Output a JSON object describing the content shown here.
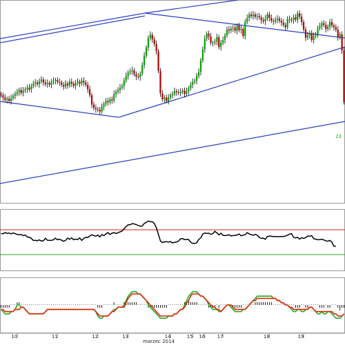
{
  "colors": {
    "background": "#ffffff",
    "bull": "#00a000",
    "bear": "#b00000",
    "wick": "#000000",
    "trendline": "#2a3fbf",
    "osc_line": "#000000",
    "overbought": "#cc2222",
    "oversold": "#22aa22",
    "macd_line": "#22aa22",
    "signal_line": "#dd2200",
    "histogram": "#000000",
    "panel_border": "#999999"
  },
  "chart_data": [
    {
      "type": "candlestick",
      "x": [
        0,
        1,
        2,
        3,
        4,
        5,
        6,
        7,
        8,
        9,
        10,
        11,
        12,
        13,
        14,
        15,
        16,
        17,
        18,
        19,
        20,
        21,
        22,
        23,
        24,
        25,
        26,
        27,
        28,
        29,
        30,
        31,
        32,
        33,
        34,
        35,
        36,
        37,
        38,
        39,
        40,
        41,
        42,
        43,
        44,
        45,
        46,
        47,
        48,
        49,
        50,
        51,
        52,
        53,
        54,
        55,
        56,
        57,
        58,
        59,
        60,
        61,
        62,
        63,
        64,
        65,
        66,
        67,
        68,
        69,
        70,
        71,
        72,
        73,
        74,
        75,
        76,
        77,
        78,
        79,
        80,
        81,
        82,
        83,
        84,
        85,
        86,
        87,
        88,
        89,
        90,
        91,
        92,
        93,
        94,
        95,
        96,
        97,
        98,
        99,
        100,
        101,
        102,
        103,
        104,
        105,
        106,
        107,
        108,
        109,
        110,
        111,
        112,
        113,
        114,
        115,
        116,
        117,
        118,
        119,
        120,
        121,
        122,
        123,
        124,
        125,
        126,
        127,
        128,
        129,
        130,
        131,
        132,
        133,
        134,
        135,
        136,
        137,
        138,
        139,
        140,
        141,
        142,
        143,
        144,
        145,
        146,
        147,
        148,
        149,
        150,
        151,
        152,
        153,
        154,
        155,
        156,
        157,
        158,
        159,
        160,
        161,
        162,
        163,
        164,
        165,
        166,
        167,
        168,
        169,
        170
      ],
      "close": [
        108,
        104,
        100,
        102,
        98,
        103,
        107,
        110,
        113,
        117,
        112,
        116,
        118,
        121,
        118,
        124,
        128,
        130,
        127,
        132,
        135,
        130,
        127,
        129,
        126,
        131,
        133,
        134,
        131,
        130,
        126,
        123,
        128,
        125,
        131,
        128,
        124,
        129,
        131,
        128,
        133,
        130,
        126,
        118,
        108,
        92,
        86,
        84,
        83,
        80,
        88,
        93,
        98,
        96,
        101,
        99,
        110,
        114,
        117,
        121,
        124,
        133,
        141,
        147,
        149,
        151,
        144,
        140,
        139,
        145,
        160,
        176,
        190,
        206,
        212,
        204,
        196,
        184,
        150,
        111,
        101,
        104,
        98,
        104,
        108,
        110,
        115,
        113,
        112,
        114,
        116,
        110,
        115,
        120,
        126,
        131,
        133,
        141,
        148,
        168,
        187,
        205,
        214,
        209,
        198,
        198,
        200,
        208,
        191,
        198,
        203,
        211,
        221,
        219,
        223,
        224,
        219,
        228,
        220,
        222,
        210,
        234,
        241,
        247,
        244,
        247,
        243,
        244,
        242,
        237,
        235,
        240,
        247,
        241,
        236,
        235,
        238,
        240,
        236,
        233,
        229,
        225,
        239,
        238,
        237,
        242,
        238,
        249,
        243,
        234,
        221,
        207,
        211,
        215,
        203,
        210,
        213,
        223,
        227,
        232,
        229,
        222,
        226,
        234,
        228,
        225,
        221,
        208,
        213,
        185,
        96
      ],
      "month_label": "marzec 2014",
      "x_tick_labels": [
        "10",
        "11",
        "12",
        "13",
        "14",
        "15",
        "16",
        "17",
        "18",
        "19"
      ],
      "x_tick_positions": [
        8,
        28,
        48,
        63,
        84,
        95,
        101,
        110,
        133,
        150
      ]
    },
    {
      "type": "line",
      "series": [
        {
          "values": [
            48,
            46,
            55,
            49,
            52,
            45,
            52,
            46,
            40,
            37,
            40,
            30,
            35,
            20,
            17,
            9,
            -8,
            -8,
            -10,
            -4,
            -12,
            -11,
            10,
            -6,
            -8,
            -8,
            -2,
            10,
            -2,
            1,
            -6,
            -15,
            -8,
            11,
            1,
            13,
            -3,
            3,
            -1,
            12,
            -8,
            7,
            18,
            15,
            28,
            38,
            31,
            26,
            35,
            20,
            40,
            30,
            45,
            55,
            40,
            50,
            55,
            47,
            54,
            61,
            67,
            85,
            104,
            118,
            118,
            127,
            125,
            119,
            113,
            107,
            108,
            129,
            138,
            148,
            143,
            142,
            128,
            95,
            42,
            -12,
            -25,
            -20,
            -18,
            -21,
            -17,
            -28,
            -23,
            -21,
            -13,
            5,
            7,
            -2,
            0,
            -1,
            -22,
            -31,
            -32,
            -28,
            0,
            12,
            44,
            51,
            49,
            50,
            41,
            48,
            65,
            53,
            36,
            50,
            33,
            31,
            33,
            38,
            28,
            31,
            32,
            36,
            44,
            29,
            35,
            38,
            55,
            45,
            38,
            33,
            41,
            34,
            16,
            9,
            10,
            1,
            22,
            28,
            25,
            24,
            23,
            23,
            23,
            24,
            24,
            28,
            34,
            43,
            47,
            18,
            12,
            18,
            3,
            14,
            8,
            15,
            27,
            26,
            30,
            5,
            3,
            -3,
            -1,
            1,
            -4,
            -12,
            -14,
            -8,
            -22,
            -55,
            -55
          ],
          "upper_level": 100,
          "lower_level": -100
        }
      ]
    },
    {
      "type": "line",
      "series": [
        {
          "values": [
            -2,
            -3,
            -4,
            -4,
            -4,
            -3,
            -3,
            -2,
            0,
            0,
            -1,
            -1,
            -2,
            -3,
            -4,
            -4,
            -4,
            -4,
            -4,
            -4,
            -4,
            -4,
            -3,
            -2,
            -2,
            -2,
            -2,
            -2,
            -2,
            -2,
            -2,
            -2,
            -2,
            -2,
            -2,
            -2,
            -2,
            -2,
            -2,
            -2,
            -2,
            -2,
            -2,
            -2,
            -2,
            -2,
            -2,
            -3,
            -5,
            -6,
            -6,
            -5,
            -5,
            -5,
            -4,
            -3,
            -2,
            -2,
            -1,
            -1,
            -1,
            0,
            2,
            4,
            5,
            6,
            6,
            6,
            5,
            5,
            4,
            3,
            2,
            0,
            -1,
            -2,
            -3,
            -4,
            -5,
            -6,
            -6,
            -6,
            -6,
            -5,
            -5,
            -5,
            -4,
            -4,
            -3,
            -2,
            -2,
            0,
            2,
            4,
            5,
            6,
            6,
            6,
            5,
            4,
            4,
            3,
            2,
            0,
            -1,
            -2,
            -2,
            -2,
            -3,
            -3,
            -2,
            -1,
            0,
            0,
            -1,
            -2,
            -3,
            -3,
            -3,
            -3,
            -2,
            -2,
            -1,
            0,
            1,
            2,
            3,
            4,
            4,
            4,
            4,
            4,
            4,
            4,
            4,
            3,
            3,
            2,
            2,
            1,
            1,
            0,
            0,
            -1,
            -2,
            -3,
            -3,
            -2,
            -2,
            -3,
            -3,
            -2,
            -2,
            -1,
            -1,
            -2,
            -3,
            -4,
            -4,
            -3,
            -4,
            -4,
            -3,
            -3,
            -4,
            -5,
            -6,
            -6,
            -6,
            -5,
            -4
          ]
        },
        {
          "values": [
            -2,
            -2,
            -3,
            -3,
            -3,
            -3,
            -3,
            -2,
            -2,
            -2,
            -1,
            -1,
            -2,
            -3,
            -4,
            -4,
            -4,
            -4,
            -4,
            -4,
            -4,
            -4,
            -3,
            -2,
            -2,
            -2,
            -2,
            -2,
            -2,
            -2,
            -2,
            -2,
            -2,
            -2,
            -2,
            -2,
            -2,
            -2,
            -2,
            -2,
            -2,
            -2,
            -2,
            -2,
            -2,
            -2,
            -2,
            -3,
            -4,
            -5,
            -5,
            -5,
            -5,
            -5,
            -4,
            -3,
            -3,
            -2,
            -1,
            -1,
            -1,
            -1,
            1,
            3,
            4,
            5,
            5,
            5,
            5,
            5,
            4,
            3,
            2,
            1,
            0,
            -1,
            -2,
            -3,
            -4,
            -5,
            -5,
            -5,
            -5,
            -5,
            -5,
            -5,
            -4,
            -4,
            -3,
            -2,
            -2,
            -1,
            1,
            2,
            4,
            5,
            5,
            5,
            5,
            4,
            4,
            3,
            2,
            1,
            0,
            -1,
            -1,
            -2,
            -2,
            -3,
            -2,
            -1,
            0,
            0,
            0,
            -1,
            -2,
            -2,
            -2,
            -2,
            -2,
            -2,
            -1,
            0,
            1,
            2,
            2,
            3,
            3,
            3,
            3,
            3,
            3,
            3,
            3,
            3,
            3,
            2,
            2,
            1,
            1,
            0,
            0,
            -1,
            -1,
            -2,
            -2,
            -2,
            -2,
            -2,
            -2,
            -2,
            -2,
            -1,
            -1,
            -2,
            -3,
            -3,
            -3,
            -3,
            -3,
            -3,
            -3,
            -3,
            -3,
            -4,
            -4,
            -5,
            -5,
            -5,
            -4
          ]
        }
      ],
      "histogram": [
        -1,
        -1,
        -1,
        -1,
        -1,
        0,
        0,
        0,
        1,
        1,
        0,
        0,
        0,
        0,
        0,
        0,
        0,
        0,
        0,
        0,
        0,
        0,
        0,
        0,
        0,
        0,
        0,
        0,
        0,
        0,
        0,
        0,
        0,
        0,
        0,
        0,
        0,
        0,
        0,
        0,
        0,
        0,
        0,
        0,
        0,
        0,
        0,
        0,
        -1,
        -1,
        -1,
        0,
        0,
        0,
        0,
        0,
        1,
        0,
        0,
        0,
        0,
        1,
        1,
        1,
        1,
        1,
        1,
        1,
        0,
        0,
        0,
        0,
        0,
        -1,
        -1,
        -1,
        -1,
        -1,
        -1,
        -1,
        -1,
        -1,
        -1,
        0,
        0,
        0,
        0,
        0,
        0,
        0,
        0,
        1,
        1,
        2,
        1,
        1,
        1,
        1,
        0,
        0,
        0,
        0,
        0,
        -1,
        -1,
        -1,
        -1,
        0,
        -1,
        0,
        0,
        0,
        0,
        0,
        0,
        -1,
        -1,
        -1,
        -1,
        -1,
        0,
        0,
        0,
        0,
        0,
        0,
        1,
        1,
        1,
        1,
        1,
        1,
        1,
        1,
        1,
        0,
        0,
        0,
        0,
        0,
        0,
        0,
        0,
        0,
        0,
        0,
        -1,
        -1,
        -1,
        0,
        0,
        -1,
        -1,
        0,
        0,
        0,
        0,
        0,
        -1,
        -1,
        -1,
        0,
        -1,
        -1,
        0,
        0,
        0,
        -1,
        -2,
        -1,
        -1,
        -1,
        0
      ]
    }
  ]
}
